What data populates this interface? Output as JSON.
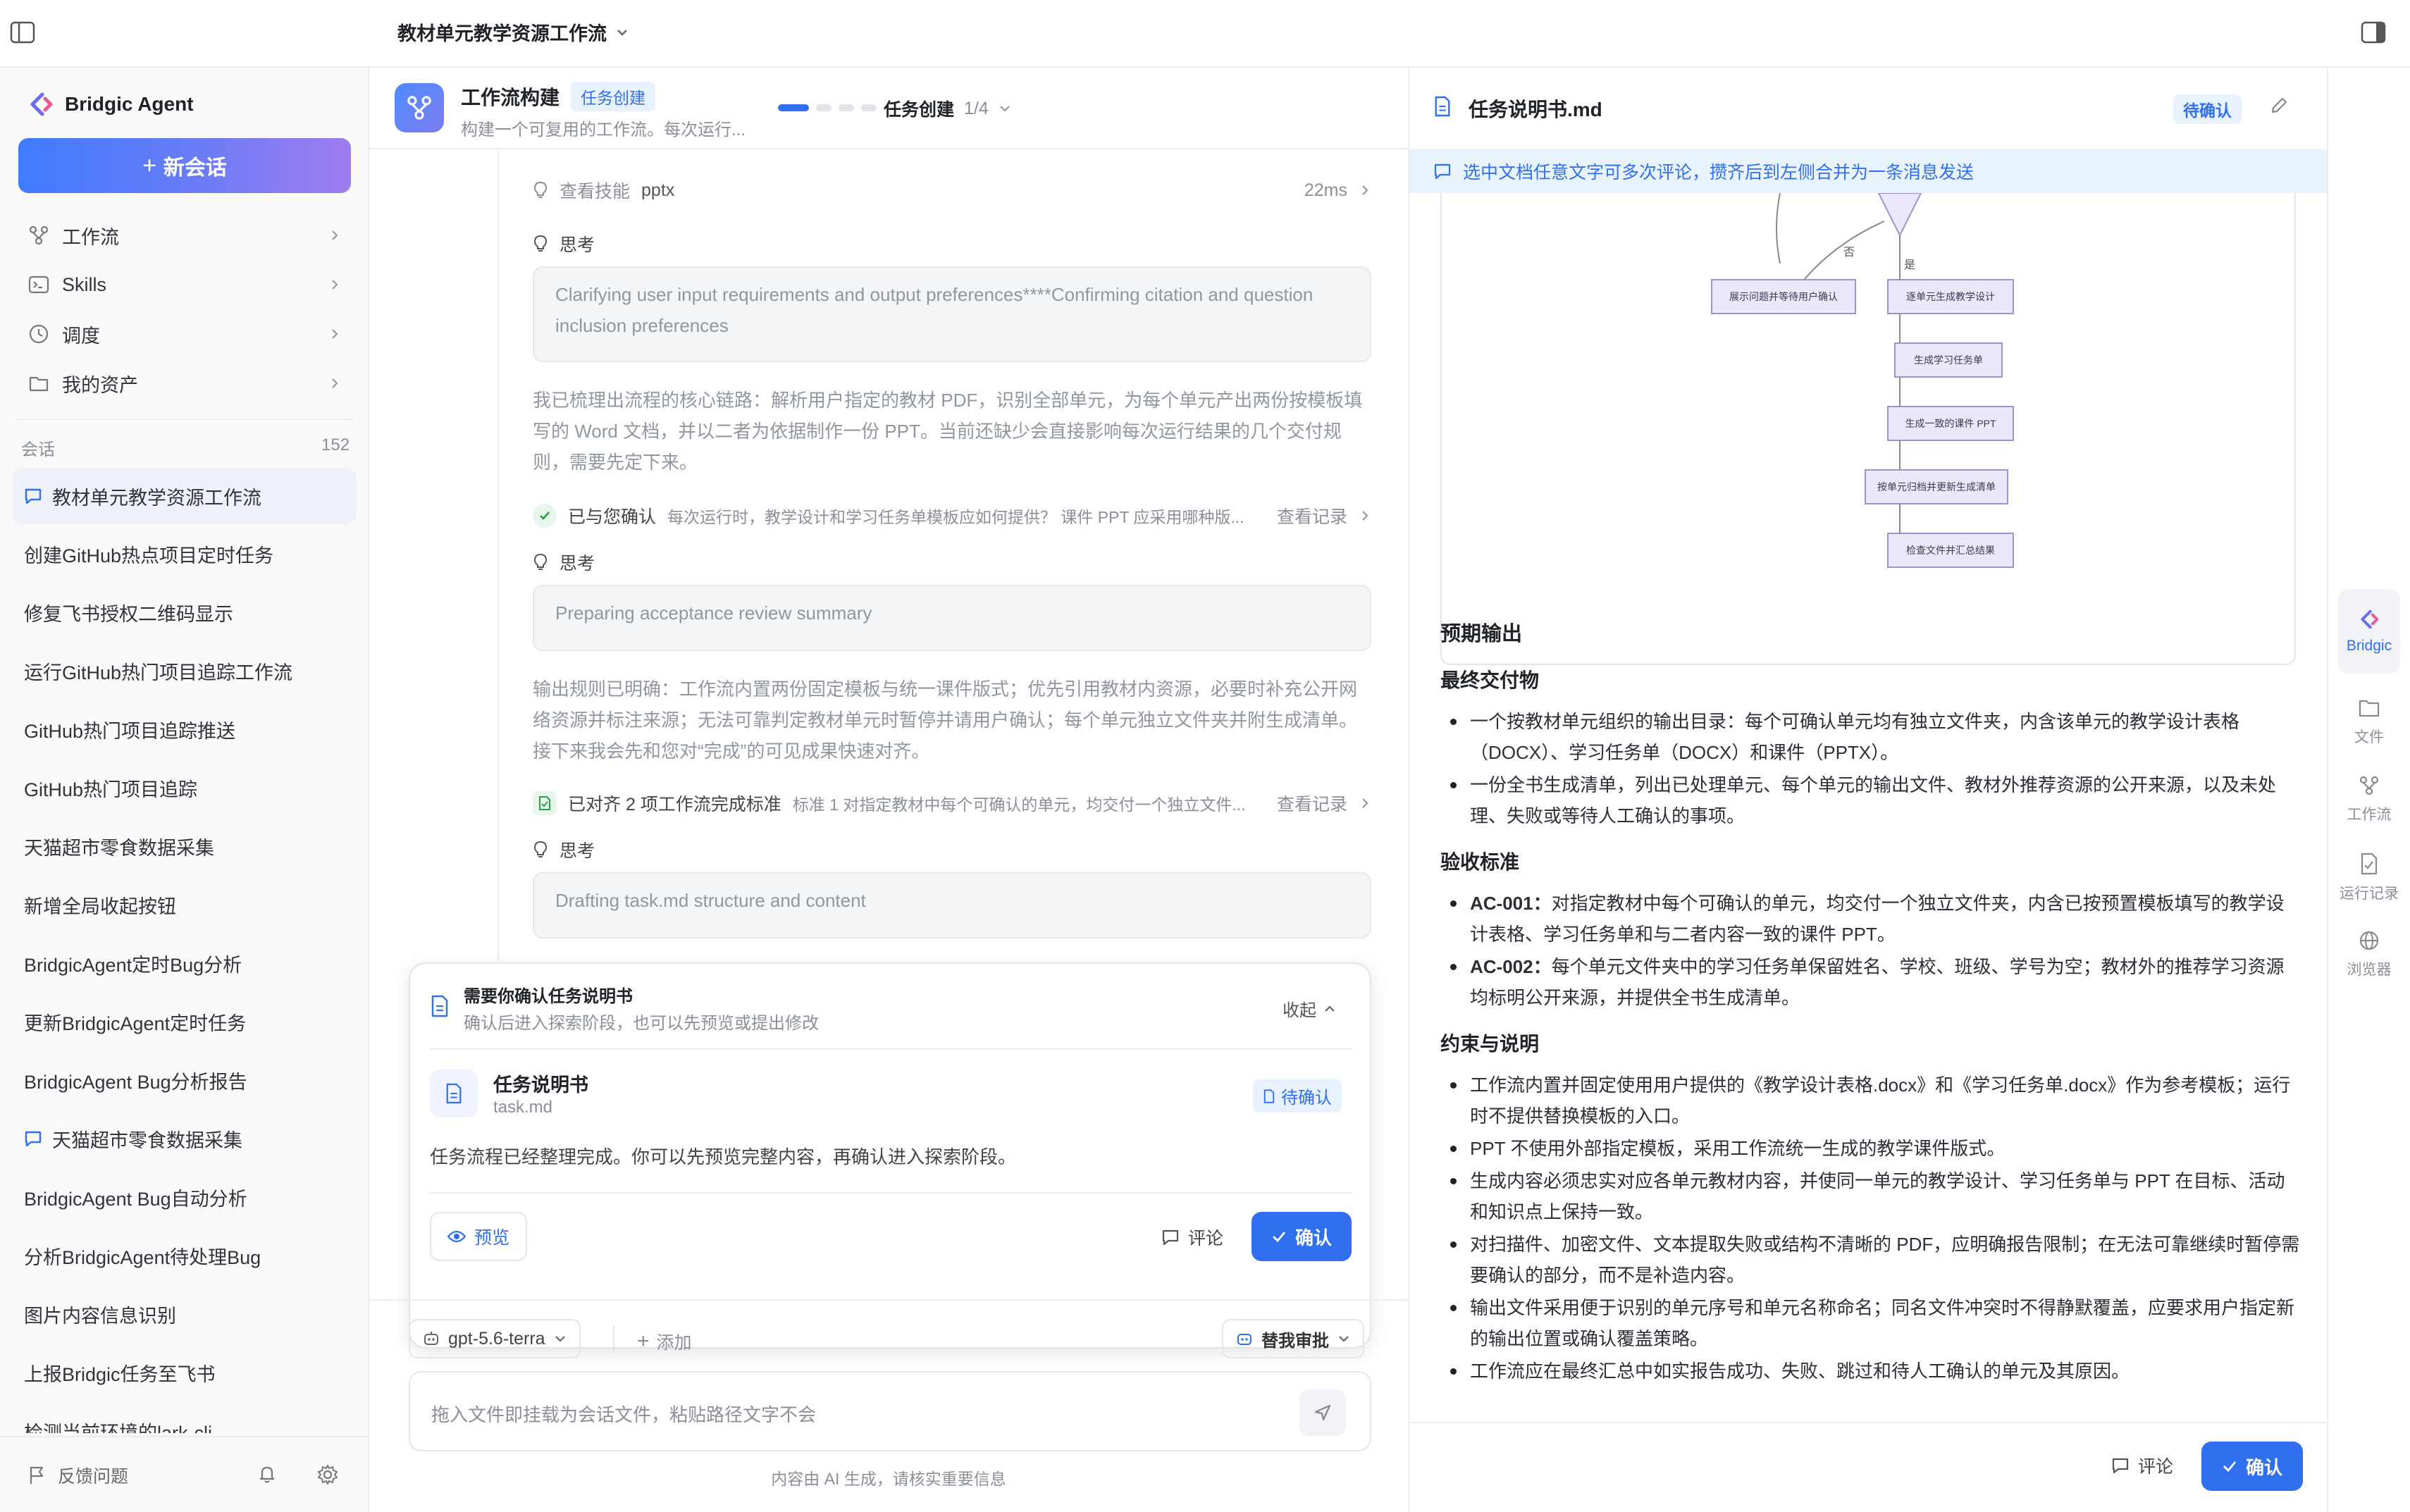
{
  "topbar": {
    "title": "教材单元教学资源工作流"
  },
  "sidebar": {
    "brand": "Bridgic Agent",
    "new_chat": "新会话",
    "nav": [
      {
        "label": "工作流",
        "icon": "workflow-icon"
      },
      {
        "label": "Skills",
        "icon": "terminal-icon"
      },
      {
        "label": "调度",
        "icon": "clock-icon"
      },
      {
        "label": "我的资产",
        "icon": "folder-icon"
      }
    ],
    "sessions_label": "会话",
    "sessions_count": "152",
    "conversations": [
      "教材单元教学资源工作流",
      "创建GitHub热点项目定时任务",
      "修复飞书授权二维码显示",
      "运行GitHub热门项目追踪工作流",
      "GitHub热门项目追踪推送",
      "GitHub热门项目追踪",
      "天猫超市零食数据采集",
      "新增全局收起按钮",
      "BridgicAgent定时Bug分析",
      "更新BridgicAgent定时任务",
      "BridgicAgent Bug分析报告",
      "天猫超市零食数据采集",
      "BridgicAgent Bug自动分析",
      "分析BridgicAgent待处理Bug",
      "图片内容信息识别",
      "上报Bridgic任务至飞书",
      "检测当前环境的lark-cli"
    ],
    "feedback": "反馈问题"
  },
  "middle": {
    "header": {
      "title": "工作流构建",
      "tag": "任务创建",
      "subtitle": "构建一个可复用的工作流。每次运行...",
      "step_label": "任务创建",
      "step_count": "1/4"
    },
    "skill_row": {
      "label": "查看技能",
      "name": "pptx",
      "time": "22ms"
    },
    "think_label": "思考",
    "think1": "Clarifying user input requirements and output preferences****Confirming citation and question inclusion preferences",
    "para1": "我已梳理出流程的核心链路：解析用户指定的教材 PDF，识别全部单元，为每个单元产出两份按模板填写的 Word 文档，并以二者为依据制作一份 PPT。当前还缺少会直接影响每次运行结果的几个交付规则，需要先定下来。",
    "confirmed": {
      "label": "已与您确认",
      "desc": "每次运行时，教学设计和学习任务单模板应如何提供？ 课件 PPT 应采用哪种版...",
      "link": "查看记录"
    },
    "think2": "Preparing acceptance review summary",
    "para2": "输出规则已明确：工作流内置两份固定模板与统一课件版式；优先引用教材内资源，必要时补充公开网络资源并标注来源；无法可靠判定教材单元时暂停并请用户确认；每个单元独立文件夹并附生成清单。接下来我会先和您对“完成”的可见成果快速对齐。",
    "aligned": {
      "label": "已对齐 2 项工作流完成标准",
      "desc": "标准 1 对指定教材中每个可确认的单元，均交付一个独立文件...",
      "link": "查看记录"
    },
    "think3": "Drafting task.md structure and content",
    "card": {
      "title": "需要你确认任务说明书",
      "subtitle": "确认后进入探索阶段，也可以先预览或提出修改",
      "collapse": "收起",
      "file_title": "任务说明书",
      "file_name": "task.md",
      "status": "待确认",
      "message": "任务流程已经整理完成。你可以先预览完整内容，再确认进入探索阶段。",
      "preview": "预览",
      "comment": "评论",
      "confirm": "确认"
    },
    "composer": {
      "model": "gpt-5.6-terra",
      "add": "添加",
      "approve": "替我审批",
      "placeholder": "拖入文件即挂载为会话文件，粘贴路径文字不会",
      "disclaimer": "内容由 AI 生成，请核实重要信息"
    }
  },
  "right": {
    "file_title": "任务说明书.md",
    "status": "待确认",
    "banner": "选中文档任意文字可多次评论，攒齐后到左侧合并为一条消息发送",
    "flow": {
      "edge_no": "否",
      "edge_yes": "是",
      "nodes": [
        "展示问题并等待用户确认",
        "逐单元生成教学设计",
        "生成学习任务单",
        "生成一致的课件 PPT",
        "按单元归档并更新生成清单",
        "检查文件并汇总结果"
      ]
    },
    "sections": {
      "expected_output": "预期输出",
      "final_deliverables": "最终交付物",
      "deliverables": [
        "一个按教材单元组织的输出目录：每个可确认单元均有独立文件夹，内含该单元的教学设计表格（DOCX）、学习任务单（DOCX）和课件（PPTX）。",
        "一份全书生成清单，列出已处理单元、每个单元的输出文件、教材外推荐资源的公开来源，以及未处理、失败或等待人工确认的事项。"
      ],
      "acceptance": "验收标准",
      "ac": [
        {
          "id": "AC-001：",
          "text": "对指定教材中每个可确认的单元，均交付一个独立文件夹，内含已按预置模板填写的教学设计表格、学习任务单和与二者内容一致的课件 PPT。"
        },
        {
          "id": "AC-002：",
          "text": "每个单元文件夹中的学习任务单保留姓名、学校、班级、学号为空；教材外的推荐学习资源均标明公开来源，并提供全书生成清单。"
        }
      ],
      "constraints": "约束与说明",
      "constraint_items": [
        "工作流内置并固定使用用户提供的《教学设计表格.docx》和《学习任务单.docx》作为参考模板；运行时不提供替换模板的入口。",
        "PPT 不使用外部指定模板，采用工作流统一生成的教学课件版式。",
        "生成内容必须忠实对应各单元教材内容，并使同一单元的教学设计、学习任务单与 PPT 在目标、活动和知识点上保持一致。",
        "对扫描件、加密文件、文本提取失败或结构不清晰的 PDF，应明确报告限制；在无法可靠继续时暂停需要确认的部分，而不是补造内容。",
        "输出文件采用便于识别的单元序号和单元名称命名；同名文件冲突时不得静默覆盖，应要求用户指定新的输出位置或确认覆盖策略。",
        "工作流应在最终汇总中如实报告成功、失败、跳过和待人工确认的单元及其原因。"
      ]
    },
    "footer": {
      "comment": "评论",
      "confirm": "确认"
    }
  },
  "rail": {
    "items": [
      {
        "label": "Bridgic",
        "icon": "bridgic-logo-icon"
      },
      {
        "label": "文件",
        "icon": "file-icon"
      },
      {
        "label": "工作流",
        "icon": "workflow-icon"
      },
      {
        "label": "运行记录",
        "icon": "run-log-icon"
      },
      {
        "label": "浏览器",
        "icon": "globe-icon"
      }
    ]
  },
  "colors": {
    "accent": "#2f6ff0",
    "accent_light": "#e8f1fe",
    "brand_gradient_start": "#3f7bff",
    "brand_gradient_end": "#a07cf0"
  }
}
